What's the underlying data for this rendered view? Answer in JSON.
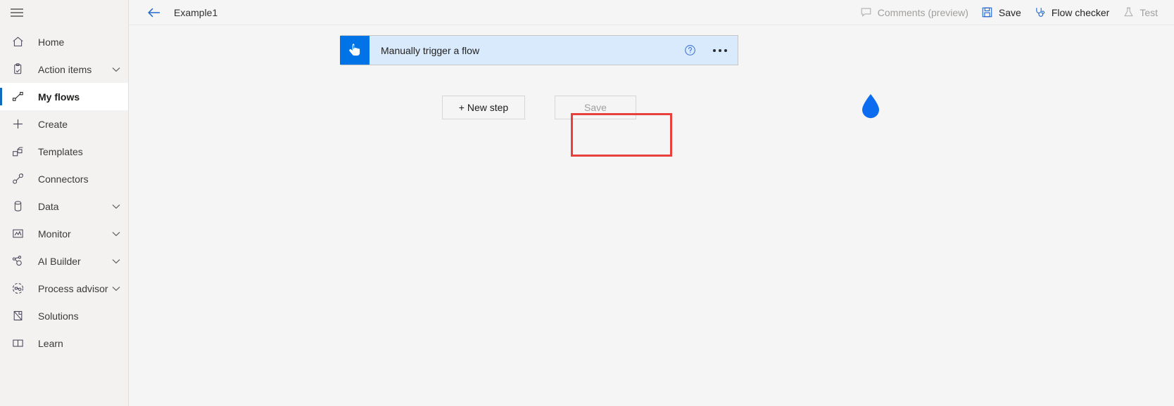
{
  "sidebar": {
    "menu_icon": "hamburger-icon",
    "items": [
      {
        "label": "Home",
        "icon": "home-icon",
        "chevron": false,
        "selected": false
      },
      {
        "label": "Action items",
        "icon": "clipboard-check-icon",
        "chevron": true,
        "selected": false
      },
      {
        "label": "My flows",
        "icon": "flow-icon",
        "chevron": false,
        "selected": true
      },
      {
        "label": "Create",
        "icon": "plus-icon",
        "chevron": false,
        "selected": false
      },
      {
        "label": "Templates",
        "icon": "templates-icon",
        "chevron": false,
        "selected": false
      },
      {
        "label": "Connectors",
        "icon": "connectors-icon",
        "chevron": false,
        "selected": false
      },
      {
        "label": "Data",
        "icon": "database-icon",
        "chevron": true,
        "selected": false
      },
      {
        "label": "Monitor",
        "icon": "monitor-chart-icon",
        "chevron": true,
        "selected": false
      },
      {
        "label": "AI Builder",
        "icon": "ai-builder-icon",
        "chevron": true,
        "selected": false
      },
      {
        "label": "Process advisor",
        "icon": "process-advisor-icon",
        "chevron": true,
        "selected": false
      },
      {
        "label": "Solutions",
        "icon": "solutions-icon",
        "chevron": false,
        "selected": false
      },
      {
        "label": "Learn",
        "icon": "book-icon",
        "chevron": false,
        "selected": false
      }
    ]
  },
  "topbar": {
    "back_icon": "back-arrow-icon",
    "title": "Example1",
    "commands": [
      {
        "label": "Comments (preview)",
        "icon": "comment-icon",
        "disabled": true
      },
      {
        "label": "Save",
        "icon": "save-disk-icon",
        "disabled": false
      },
      {
        "label": "Flow checker",
        "icon": "stethoscope-icon",
        "disabled": false
      },
      {
        "label": "Test",
        "icon": "flask-icon",
        "disabled": true
      }
    ]
  },
  "canvas": {
    "trigger_card": {
      "icon": "tap-hand-icon",
      "title": "Manually trigger a flow",
      "help_icon": "help-circle-icon",
      "more_icon": "ellipsis-icon"
    },
    "buttons": {
      "new_step_label": "+ New step",
      "save_label": "Save"
    },
    "highlight": {
      "name": "new-step-highlight",
      "color": "#e8413b"
    },
    "pointer": {
      "name": "click-pointer-marker",
      "color": "#0b6cf0"
    }
  },
  "colors": {
    "accent_blue": "#0073e6",
    "card_fill": "#d9eafc",
    "sidebar_bg": "#f3f2f1",
    "canvas_bg": "#f5f5f5",
    "selection_bar": "#0f6cbd",
    "highlight_red": "#e8413b"
  }
}
